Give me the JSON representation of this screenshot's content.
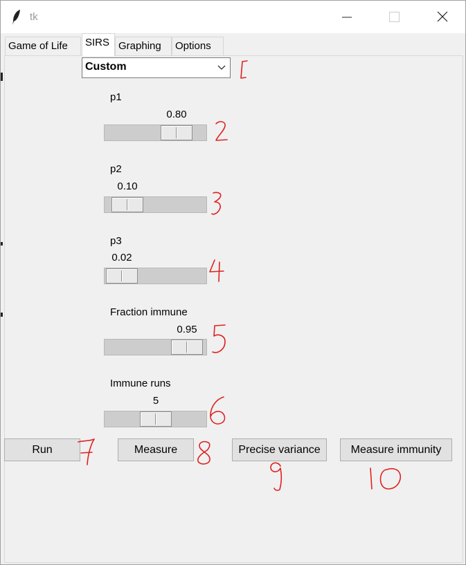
{
  "window": {
    "title": "tk"
  },
  "tabs": [
    {
      "label": "Game of Life"
    },
    {
      "label": "SIRS"
    },
    {
      "label": "Graphing"
    },
    {
      "label": "Options"
    }
  ],
  "preset_select": {
    "value": "Custom"
  },
  "sliders": [
    {
      "label": "p1",
      "value_text": "0.80",
      "fraction": 0.8
    },
    {
      "label": "p2",
      "value_text": "0.10",
      "fraction": 0.1
    },
    {
      "label": "p3",
      "value_text": "0.02",
      "fraction": 0.02
    },
    {
      "label": "Fraction immune",
      "value_text": "0.95",
      "fraction": 0.95
    },
    {
      "label": "Immune runs",
      "value_text": "5",
      "fraction": 0.5
    }
  ],
  "buttons": {
    "run": "Run",
    "measure": "Measure",
    "precise_variance": "Precise variance",
    "measure_immunity": "Measure immunity"
  },
  "annotations": [
    "1",
    "2",
    "3",
    "4",
    "5",
    "6",
    "7",
    "8",
    "9",
    "10"
  ],
  "colors": {
    "annotation_ink": "#e02020",
    "window_bg": "#f0f0f0",
    "trough": "#cdcdcd"
  }
}
